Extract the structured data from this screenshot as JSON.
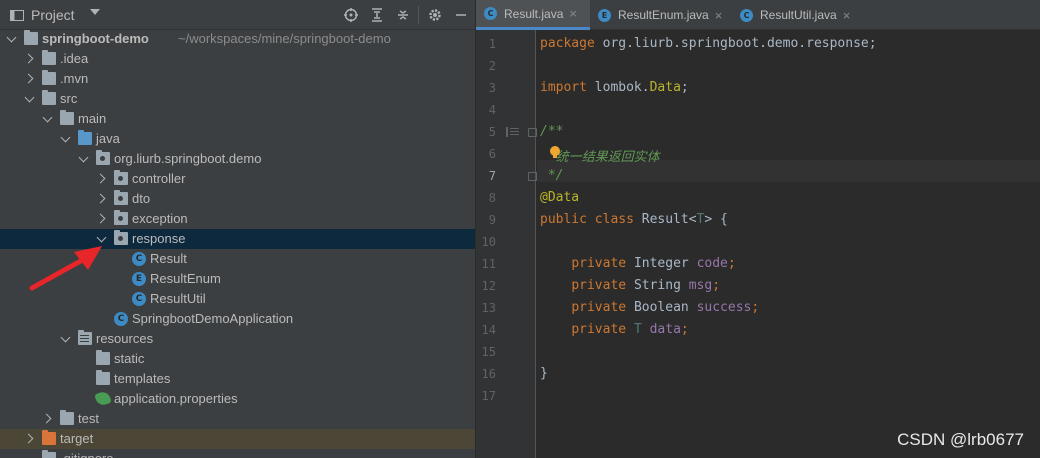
{
  "project": {
    "title": "Project",
    "header_icons": [
      "crosshair-icon",
      "collapse-all-icon",
      "expand-all-icon",
      "gear-icon",
      "minimize-icon"
    ]
  },
  "tree": [
    {
      "label": "springboot-demo",
      "path": "~/workspaces/mine/springboot-demo",
      "depth": 0,
      "expanded": true,
      "icon": "module-folder-icon"
    },
    {
      "label": ".idea",
      "depth": 1,
      "expanded": false,
      "icon": "folder-icon"
    },
    {
      "label": ".mvn",
      "depth": 1,
      "expanded": false,
      "icon": "folder-icon"
    },
    {
      "label": "src",
      "depth": 1,
      "expanded": true,
      "icon": "folder-icon"
    },
    {
      "label": "main",
      "depth": 2,
      "expanded": true,
      "icon": "folder-icon"
    },
    {
      "label": "java",
      "depth": 3,
      "expanded": true,
      "icon": "source-folder-icon"
    },
    {
      "label": "org.liurb.springboot.demo",
      "depth": 4,
      "expanded": true,
      "icon": "package-icon"
    },
    {
      "label": "controller",
      "depth": 5,
      "expanded": false,
      "icon": "package-icon"
    },
    {
      "label": "dto",
      "depth": 5,
      "expanded": false,
      "icon": "package-icon"
    },
    {
      "label": "exception",
      "depth": 5,
      "expanded": false,
      "icon": "package-icon"
    },
    {
      "label": "response",
      "depth": 5,
      "expanded": true,
      "icon": "package-icon",
      "selected": true
    },
    {
      "label": "Result",
      "depth": 6,
      "icon": "class-icon",
      "glyph": "C"
    },
    {
      "label": "ResultEnum",
      "depth": 6,
      "icon": "enum-icon",
      "glyph": "E"
    },
    {
      "label": "ResultUtil",
      "depth": 6,
      "icon": "class-icon",
      "glyph": "C"
    },
    {
      "label": "SpringbootDemoApplication",
      "depth": 5,
      "icon": "spring-app-icon",
      "glyph": "C"
    },
    {
      "label": "resources",
      "depth": 3,
      "expanded": true,
      "icon": "resources-folder-icon"
    },
    {
      "label": "static",
      "depth": 4,
      "icon": "folder-icon"
    },
    {
      "label": "templates",
      "depth": 4,
      "icon": "folder-icon"
    },
    {
      "label": "application.properties",
      "depth": 4,
      "icon": "properties-file-icon"
    },
    {
      "label": "test",
      "depth": 2,
      "expanded": false,
      "icon": "folder-icon"
    },
    {
      "label": "target",
      "depth": 1,
      "expanded": false,
      "icon": "excluded-folder-icon",
      "highlighted": true
    },
    {
      "label": ".gitignore",
      "depth": 1,
      "icon": "file-icon"
    }
  ],
  "tabs": [
    {
      "label": "Result.java",
      "glyph": "C",
      "active": true
    },
    {
      "label": "ResultEnum.java",
      "glyph": "E",
      "active": false
    },
    {
      "label": "ResultUtil.java",
      "glyph": "C",
      "active": false
    }
  ],
  "close_glyph": "×",
  "code": [
    {
      "n": "1",
      "tokens": [
        [
          "kw",
          "package "
        ],
        [
          "plain",
          "org.liurb.springboot.demo.response;"
        ]
      ]
    },
    {
      "n": "2",
      "tokens": []
    },
    {
      "n": "3",
      "tokens": [
        [
          "kw",
          "import "
        ],
        [
          "plain",
          "lombok."
        ],
        [
          "ann",
          "Data"
        ],
        [
          "plain",
          ";"
        ]
      ]
    },
    {
      "n": "4",
      "tokens": []
    },
    {
      "n": "5",
      "tokens": [
        [
          "doc",
          "/**"
        ]
      ]
    },
    {
      "n": "6",
      "tokens": [
        [
          "doc",
          "  统一结果返回实体"
        ]
      ]
    },
    {
      "n": "7",
      "tokens": [
        [
          "doc",
          " */"
        ]
      ]
    },
    {
      "n": "8",
      "tokens": [
        [
          "ann",
          "@Data"
        ]
      ]
    },
    {
      "n": "9",
      "tokens": [
        [
          "kw",
          "public class "
        ],
        [
          "plain",
          "Result<"
        ],
        [
          "tp",
          "T"
        ],
        [
          "plain",
          "> {"
        ]
      ]
    },
    {
      "n": "10",
      "tokens": []
    },
    {
      "n": "11",
      "tokens": [
        [
          "plain",
          "    "
        ],
        [
          "kw",
          "private "
        ],
        [
          "plain",
          "Integer "
        ],
        [
          "field",
          "code"
        ],
        [
          "kw",
          ";"
        ]
      ]
    },
    {
      "n": "12",
      "tokens": [
        [
          "plain",
          "    "
        ],
        [
          "kw",
          "private "
        ],
        [
          "plain",
          "String "
        ],
        [
          "field",
          "msg"
        ],
        [
          "kw",
          ";"
        ]
      ]
    },
    {
      "n": "13",
      "tokens": [
        [
          "plain",
          "    "
        ],
        [
          "kw",
          "private "
        ],
        [
          "plain",
          "Boolean "
        ],
        [
          "field",
          "success"
        ],
        [
          "kw",
          ";"
        ]
      ]
    },
    {
      "n": "14",
      "tokens": [
        [
          "plain",
          "    "
        ],
        [
          "kw",
          "private "
        ],
        [
          "tp",
          "T "
        ],
        [
          "field",
          "data"
        ],
        [
          "kw",
          ";"
        ]
      ]
    },
    {
      "n": "15",
      "tokens": []
    },
    {
      "n": "16",
      "tokens": [
        [
          "plain",
          "}"
        ]
      ]
    },
    {
      "n": "17",
      "tokens": []
    }
  ],
  "current_line": "7",
  "watermark": "CSDN @lrb0677"
}
